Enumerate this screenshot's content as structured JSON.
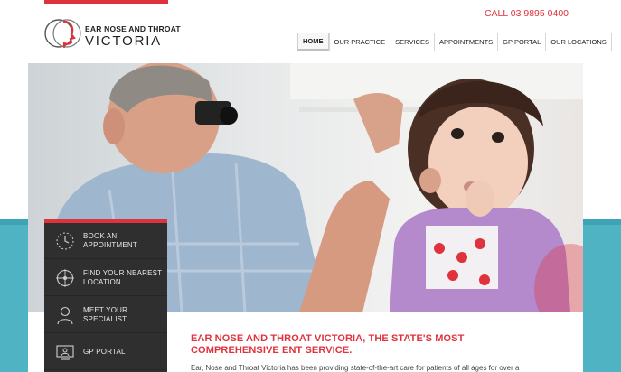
{
  "header": {
    "logo_line1": "EAR NOSE AND THROAT",
    "logo_line2": "VICTORIA",
    "call": "CALL 03 9895 0400"
  },
  "nav": {
    "items": [
      "HOME",
      "OUR PRACTICE",
      "SERVICES",
      "APPOINTMENTS",
      "GP PORTAL",
      "OUR LOCATIONS"
    ],
    "active": "HOME"
  },
  "side_menu": {
    "items": [
      {
        "label": "BOOK AN APPOINTMENT",
        "icon": "clock-icon"
      },
      {
        "label": "FIND YOUR NEAREST LOCATION",
        "icon": "location-target-icon"
      },
      {
        "label": "MEET YOUR SPECIALIST",
        "icon": "person-icon"
      },
      {
        "label": "GP PORTAL",
        "icon": "computer-user-icon"
      }
    ]
  },
  "content": {
    "headline": "EAR NOSE AND THROAT VICTORIA, THE STATE'S MOST COMPREHENSIVE ENT SERVICE.",
    "intro": "Ear, Nose and Throat Victoria has been providing state-of-the-art care for patients of all ages for over a"
  },
  "colors": {
    "accent": "#e0323c",
    "teal": "#4fb3c4",
    "menu_bg": "#2f2f2f"
  }
}
